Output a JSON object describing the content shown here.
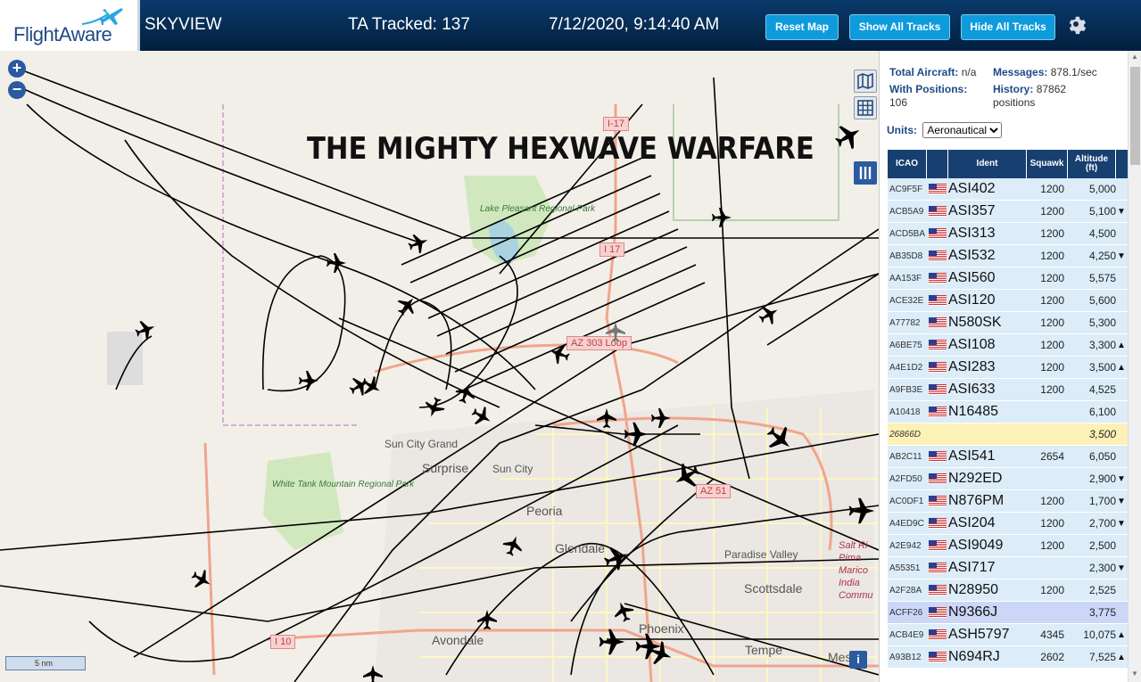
{
  "header": {
    "logo_text": "FlightAware",
    "app_name": "SKYVIEW",
    "tracked_label": "TA Tracked: 137",
    "datetime": "7/12/2020, 9:14:40 AM",
    "buttons": {
      "reset_map": "Reset Map",
      "show_all": "Show All Tracks",
      "hide_all": "Hide All Tracks"
    },
    "settings_icon": "gear-icon"
  },
  "map": {
    "overlay_title": "THE MIGHTY HEXWAVE WARFARE",
    "zoom_in": "+",
    "zoom_out": "−",
    "scale_label": "5 nm",
    "info_label": "i",
    "labels": {
      "lake_pleasant": "Lake Pleasant Regional Park",
      "white_tank": "White Tank Mountain Regional Park",
      "sun_city_grand": "Sun City Grand",
      "surprise": "Surprise",
      "sun_city": "Sun City",
      "peoria": "Peoria",
      "glendale": "Glendale",
      "paradise_valley": "Paradise Valley",
      "scottsdale": "Scottsdale",
      "phoenix": "Phoenix",
      "avondale": "Avondale",
      "tempe": "Tempe",
      "mesa": "Mesa",
      "salt_river": "Salt Ri Pima Marico India Commu",
      "i17_a": "I-17",
      "i17_b": "I 17",
      "az303": "AZ 303 Loop",
      "az51": "AZ 51",
      "i10": "I 10"
    },
    "colors": {
      "land": "#f2efe9",
      "road_major": "#f4b39b",
      "road_minor": "#fff6c4",
      "park": "#c8e6b4",
      "water": "#aad3df",
      "track": "#000000"
    }
  },
  "panel": {
    "stats": {
      "total_aircraft_label": "Total Aircraft:",
      "total_aircraft_value": "n/a",
      "messages_label": "Messages:",
      "messages_value": "878.1/sec",
      "with_positions_label": "With Positions:",
      "with_positions_value": "106",
      "history_label": "History:",
      "history_value": "87862",
      "history_unit": "positions"
    },
    "units_label": "Units:",
    "units_selected": "Aeronautical",
    "columns": {
      "icao": "ICAO",
      "ident": "Ident",
      "squawk": "Squawk",
      "altitude": "Altitude (ft)"
    },
    "rows": [
      {
        "icao": "AC9F5F",
        "flag": "us",
        "ident": "ASI402",
        "squawk": "1200",
        "alt": "5,000",
        "arrow": ""
      },
      {
        "icao": "ACB5A9",
        "flag": "us",
        "ident": "ASI357",
        "squawk": "1200",
        "alt": "5,100",
        "arrow": "▼"
      },
      {
        "icao": "ACD5BA",
        "flag": "us",
        "ident": "ASI313",
        "squawk": "1200",
        "alt": "4,500",
        "arrow": ""
      },
      {
        "icao": "AB35D8",
        "flag": "us",
        "ident": "ASI532",
        "squawk": "1200",
        "alt": "4,250",
        "arrow": "▼"
      },
      {
        "icao": "AA153F",
        "flag": "us",
        "ident": "ASI560",
        "squawk": "1200",
        "alt": "5,575",
        "arrow": ""
      },
      {
        "icao": "ACE32E",
        "flag": "us",
        "ident": "ASI120",
        "squawk": "1200",
        "alt": "5,600",
        "arrow": ""
      },
      {
        "icao": "A77782",
        "flag": "us",
        "ident": "N580SK",
        "squawk": "1200",
        "alt": "5,300",
        "arrow": ""
      },
      {
        "icao": "A6BE75",
        "flag": "us",
        "ident": "ASI108",
        "squawk": "1200",
        "alt": "3,300",
        "arrow": "▲"
      },
      {
        "icao": "A4E1D2",
        "flag": "us",
        "ident": "ASI283",
        "squawk": "1200",
        "alt": "3,500",
        "arrow": "▲"
      },
      {
        "icao": "A9FB3E",
        "flag": "us",
        "ident": "ASI633",
        "squawk": "1200",
        "alt": "4,525",
        "arrow": ""
      },
      {
        "icao": "A10418",
        "flag": "us",
        "ident": "N16485",
        "squawk": "",
        "alt": "6,100",
        "arrow": ""
      },
      {
        "icao": "26866D",
        "flag": "",
        "ident": "",
        "squawk": "",
        "alt": "3,500",
        "arrow": "",
        "style": "hl"
      },
      {
        "icao": "AB2C11",
        "flag": "us",
        "ident": "ASI541",
        "squawk": "2654",
        "alt": "6,050",
        "arrow": ""
      },
      {
        "icao": "A2FD50",
        "flag": "us",
        "ident": "N292ED",
        "squawk": "",
        "alt": "2,900",
        "arrow": "▼"
      },
      {
        "icao": "AC0DF1",
        "flag": "us",
        "ident": "N876PM",
        "squawk": "1200",
        "alt": "1,700",
        "arrow": "▼"
      },
      {
        "icao": "A4ED9C",
        "flag": "us",
        "ident": "ASI204",
        "squawk": "1200",
        "alt": "2,700",
        "arrow": "▼"
      },
      {
        "icao": "A2E942",
        "flag": "us",
        "ident": "ASI9049",
        "squawk": "1200",
        "alt": "2,500",
        "arrow": ""
      },
      {
        "icao": "A55351",
        "flag": "us",
        "ident": "ASI717",
        "squawk": "",
        "alt": "2,300",
        "arrow": "▼"
      },
      {
        "icao": "A2F28A",
        "flag": "us",
        "ident": "N28950",
        "squawk": "1200",
        "alt": "2,525",
        "arrow": ""
      },
      {
        "icao": "ACFF26",
        "flag": "us",
        "ident": "N9366J",
        "squawk": "",
        "alt": "3,775",
        "arrow": "",
        "style": "sel"
      },
      {
        "icao": "ACB4E9",
        "flag": "us",
        "ident": "ASH5797",
        "squawk": "4345",
        "alt": "10,075",
        "arrow": "▲"
      },
      {
        "icao": "A93B12",
        "flag": "us",
        "ident": "N694RJ",
        "squawk": "2602",
        "alt": "7,525",
        "arrow": "▲"
      }
    ]
  }
}
